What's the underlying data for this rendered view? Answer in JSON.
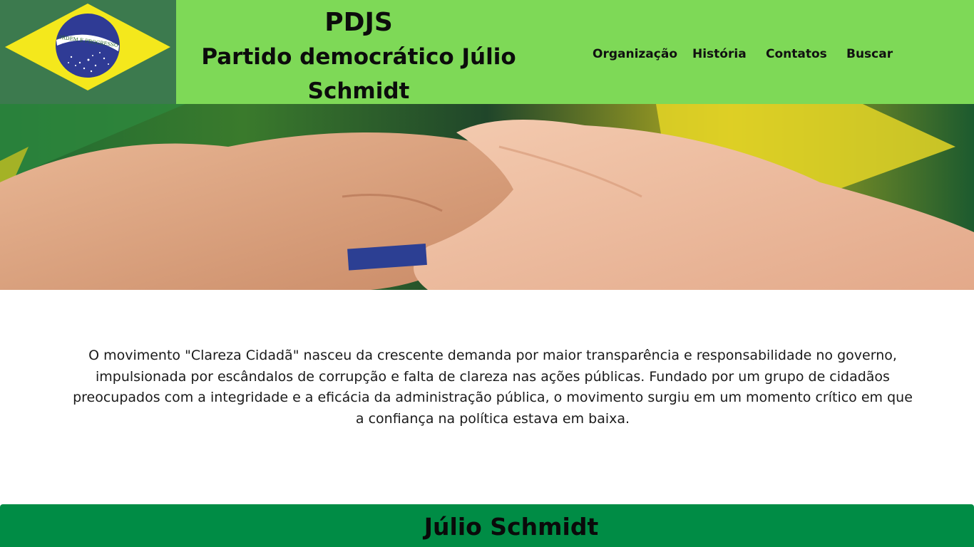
{
  "header": {
    "abbr": "PDJS",
    "party_name_line1": "Partido democrático Júlio",
    "party_name_line2": "Schmidt",
    "logo_motto": "ORDEM E PROGRESSO",
    "background_color": "#7ed957",
    "logo_icon": "brazil-flag-icon"
  },
  "nav": {
    "items": [
      {
        "label": "Organização"
      },
      {
        "label": "História"
      },
      {
        "label": "Contatos"
      },
      {
        "label": "Buscar"
      }
    ]
  },
  "hero": {
    "image": "hands-holding-over-brazil-flag"
  },
  "intro": {
    "text": "O movimento \"Clareza Cidadã\" nasceu da crescente demanda por maior transparência e responsabilidade no governo, impulsionada por escândalos de corrupção e falta de clareza nas ações públicas. Fundado por um grupo de cidadãos preocupados com a integridade e a eficácia da administração pública, o movimento surgiu em um momento crítico em que a confiança na política estava em baixa."
  },
  "footer": {
    "name": "Júlio Schmidt",
    "background_color": "#008c45"
  }
}
